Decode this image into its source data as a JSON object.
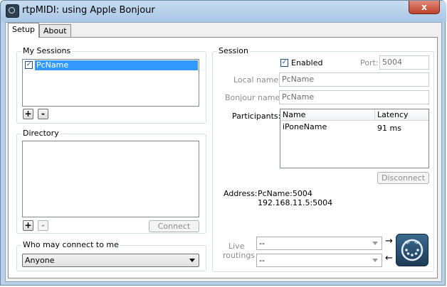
{
  "window": {
    "title": "rtpMIDI: using Apple Bonjour",
    "close_glyph": "x"
  },
  "tabs": [
    {
      "label": "Setup",
      "active": true
    },
    {
      "label": "About",
      "active": false
    }
  ],
  "my_sessions": {
    "label": "My Sessions",
    "items": [
      {
        "name": "PcName",
        "checked": true,
        "selected": true
      }
    ],
    "add_label": "+",
    "remove_label": "-"
  },
  "directory": {
    "label": "Directory",
    "add_label": "+",
    "remove_label": "-",
    "connect_label": "Connect"
  },
  "who_may_connect": {
    "label": "Who may connect to me",
    "value": "Anyone"
  },
  "session": {
    "label": "Session",
    "enabled_label": "Enabled",
    "enabled_checked": true,
    "port_label": "Port:",
    "port_value": "5004",
    "local_name_label": "Local name:",
    "local_name_value": "PcName",
    "bonjour_name_label": "Bonjour name:",
    "bonjour_name_value": "PcName",
    "participants_label": "Participants:",
    "participants_columns": [
      "Name",
      "Latency"
    ],
    "participants": [
      {
        "name": "iPoneName",
        "latency": "91 ms"
      }
    ],
    "disconnect_label": "Disconnect",
    "address_label": "Address:",
    "address_line1": "PcName:5004",
    "address_line2": "192.168.11.5:5004",
    "live_routings_label_1": "Live",
    "live_routings_label_2": "routings",
    "routing_in_value": "--",
    "routing_out_value": "--",
    "arrow_out": "→",
    "arrow_in": "←"
  },
  "colors": {
    "selection": "#3399ff",
    "titlebar": "#b9d1ea",
    "close": "#c0412b"
  }
}
